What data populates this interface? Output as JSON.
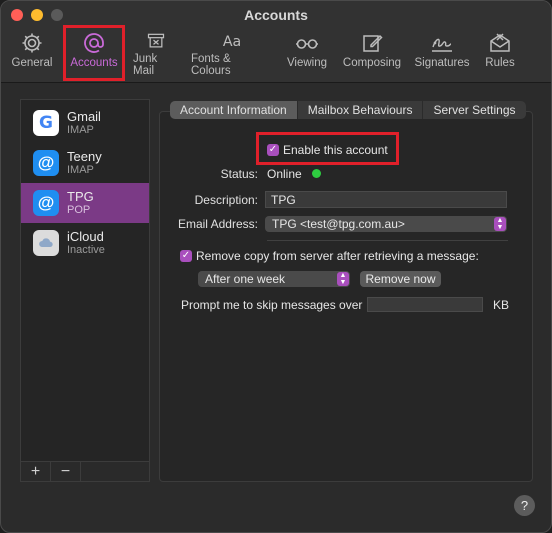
{
  "window": {
    "title": "Accounts"
  },
  "toolbar": {
    "items": [
      {
        "label": "General",
        "icon": "gear-icon"
      },
      {
        "label": "Accounts",
        "icon": "at-icon"
      },
      {
        "label": "Junk Mail",
        "icon": "trash-bin-icon"
      },
      {
        "label": "Fonts & Colours",
        "icon": "font-icon"
      },
      {
        "label": "Viewing",
        "icon": "glasses-icon"
      },
      {
        "label": "Composing",
        "icon": "compose-icon"
      },
      {
        "label": "Signatures",
        "icon": "signature-icon"
      },
      {
        "label": "Rules",
        "icon": "rules-icon"
      }
    ],
    "accent": "#c96ad8"
  },
  "sidebar": {
    "accounts": [
      {
        "name": "Gmail",
        "type": "IMAP",
        "icon": "google-icon"
      },
      {
        "name": "Teeny",
        "type": "IMAP",
        "icon": "at-icon"
      },
      {
        "name": "TPG",
        "type": "POP",
        "icon": "at-icon"
      },
      {
        "name": "iCloud",
        "type": "Inactive",
        "icon": "icloud-icon"
      }
    ],
    "add_label": "+",
    "remove_label": "−",
    "selected_color": "#7b3a86"
  },
  "tabs": [
    "Account Information",
    "Mailbox Behaviours",
    "Server Settings"
  ],
  "account_info": {
    "enable_label": "Enable this account",
    "enable_checked": true,
    "status_label": "Status:",
    "status_value": "Online",
    "status_color": "#2ecc40",
    "description_label": "Description:",
    "description_value": "TPG",
    "email_label": "Email Address:",
    "email_value": "TPG <test@tpg.com.au>",
    "remove_copy_label": "Remove copy from server after retrieving a message:",
    "remove_copy_checked": true,
    "remove_period": "After one week",
    "remove_now_label": "Remove now",
    "prompt_label": "Prompt me to skip messages over",
    "prompt_value": "",
    "prompt_unit": "KB"
  },
  "help_label": "?"
}
